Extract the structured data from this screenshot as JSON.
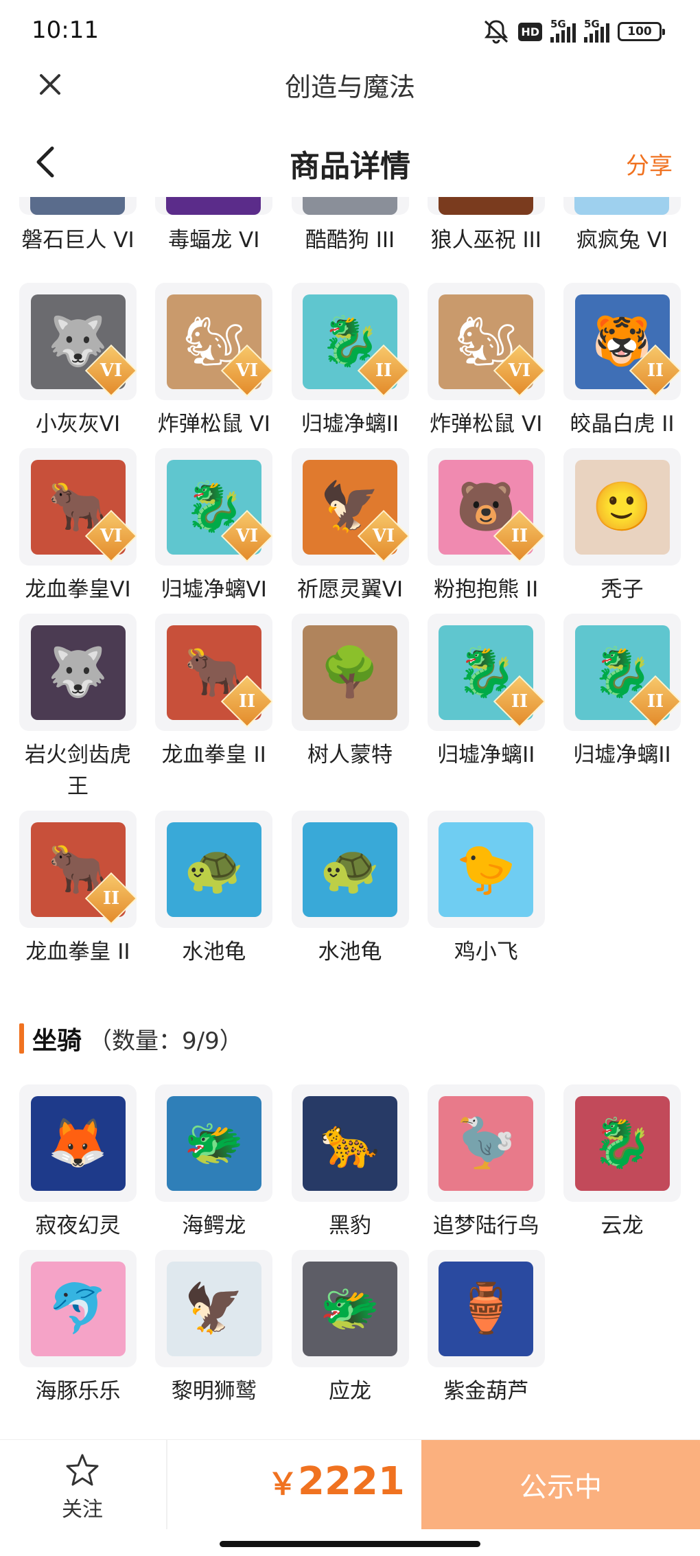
{
  "status_bar": {
    "time": "10:11",
    "hd": "HD",
    "net1": "5G",
    "net2": "5G",
    "battery": "100"
  },
  "app": {
    "title": "创造与魔法"
  },
  "nav": {
    "title": "商品详情",
    "share": "分享"
  },
  "cut_row": [
    {
      "name": "磐石巨人 VI",
      "color": "#5a6c8c"
    },
    {
      "name": "毒蝠龙 VI",
      "color": "#5b2c8a"
    },
    {
      "name": "酷酷狗 III",
      "color": "#8a8f99"
    },
    {
      "name": "狼人巫祝 III",
      "color": "#7a3b1e"
    },
    {
      "name": "疯疯兔 VI",
      "color": "#9ed0ee"
    }
  ],
  "pets": [
    {
      "name": "小灰灰VI",
      "tier": "VI",
      "color": "#6b6b6f",
      "glyph": "🐺"
    },
    {
      "name": "炸弹松鼠 VI",
      "tier": "VI",
      "color": "#c99a6c",
      "glyph": "🐿"
    },
    {
      "name": "归墟净螭II",
      "tier": "II",
      "color": "#5fc6cf",
      "glyph": "🐉"
    },
    {
      "name": "炸弹松鼠 VI",
      "tier": "VI",
      "color": "#c99a6c",
      "glyph": "🐿"
    },
    {
      "name": "皎晶白虎 II",
      "tier": "II",
      "color": "#3f6fb6",
      "glyph": "🐯"
    },
    {
      "name": "龙血拳皇VI",
      "tier": "VI",
      "color": "#c8503a",
      "glyph": "🐂"
    },
    {
      "name": "归墟净螭VI",
      "tier": "VI",
      "color": "#5fc6cf",
      "glyph": "🐉"
    },
    {
      "name": "祈愿灵翼VI",
      "tier": "VI",
      "color": "#e07a2e",
      "glyph": "🦅"
    },
    {
      "name": "粉抱抱熊 II",
      "tier": "II",
      "color": "#f08ab0",
      "glyph": "🐻"
    },
    {
      "name": "秃子",
      "tier": "",
      "color": "#e9d3c0",
      "glyph": "🙂"
    },
    {
      "name": "岩火剑齿虎王",
      "tier": "",
      "color": "#4b3b52",
      "glyph": "🐺"
    },
    {
      "name": "龙血拳皇 II",
      "tier": "II",
      "color": "#c8503a",
      "glyph": "🐂"
    },
    {
      "name": "树人蒙特",
      "tier": "",
      "color": "#b0845c",
      "glyph": "🌳"
    },
    {
      "name": "归墟净螭II",
      "tier": "II",
      "color": "#5fc6cf",
      "glyph": "🐉"
    },
    {
      "name": "归墟净螭II",
      "tier": "II",
      "color": "#5fc6cf",
      "glyph": "🐉"
    },
    {
      "name": "龙血拳皇 II",
      "tier": "II",
      "color": "#c8503a",
      "glyph": "🐂"
    },
    {
      "name": "水池龟",
      "tier": "",
      "color": "#39a9d8",
      "glyph": "🐢"
    },
    {
      "name": "水池龟",
      "tier": "",
      "color": "#39a9d8",
      "glyph": "🐢"
    },
    {
      "name": "鸡小飞",
      "tier": "",
      "color": "#6fcdf2",
      "glyph": "🐤"
    }
  ],
  "mounts_section": {
    "title": "坐骑",
    "count": "（数量：9/9）"
  },
  "mounts": [
    {
      "name": "寂夜幻灵",
      "color": "#1e3a8a",
      "glyph": "🦊"
    },
    {
      "name": "海鳄龙",
      "color": "#2f7fb8",
      "glyph": "🐲"
    },
    {
      "name": "黑豹",
      "color": "#273a66",
      "glyph": "🐆"
    },
    {
      "name": "追梦陆行鸟",
      "color": "#e87a8a",
      "glyph": "🦤"
    },
    {
      "name": "云龙",
      "color": "#c24a5a",
      "glyph": "🐉"
    },
    {
      "name": "海豚乐乐",
      "color": "#f5a3c7",
      "glyph": "🐬"
    },
    {
      "name": "黎明狮鹫",
      "color": "#dfe8ee",
      "glyph": "🦅"
    },
    {
      "name": "应龙",
      "color": "#5d5d66",
      "glyph": "🐲"
    },
    {
      "name": "紫金葫芦",
      "color": "#2a4aa0",
      "glyph": "🏺"
    }
  ],
  "bottom": {
    "follow": "关注",
    "price_symbol": "￥",
    "price": "2221",
    "status": "公示中"
  }
}
